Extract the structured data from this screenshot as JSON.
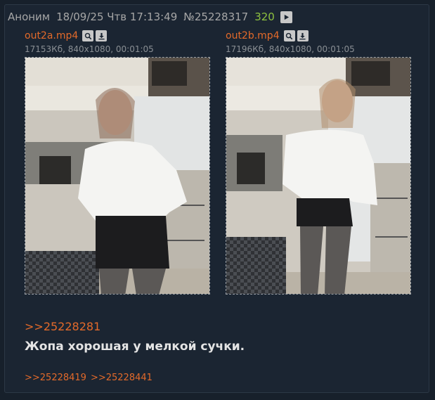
{
  "post": {
    "author": "Аноним",
    "date": "18/09/25 Чтв 17:13:49",
    "number": "№25228317",
    "replies_count": "320",
    "play_icon": "play-icon"
  },
  "files": [
    {
      "name": "out2a.mp4",
      "meta": "17153Кб, 840x1080, 00:01:05",
      "search_icon": "search-icon",
      "download_icon": "download-icon"
    },
    {
      "name": "out2b.mp4",
      "meta": "17196Кб, 840x1080, 00:01:05",
      "search_icon": "search-icon",
      "download_icon": "download-icon"
    }
  ],
  "reply_to": ">>25228281",
  "comment": "Жопа хорошая у мелкой сучки.",
  "backlinks": [
    ">>25228419",
    ">>25228441"
  ],
  "colors": {
    "background": "#17202b",
    "post_background": "#1b2532",
    "link": "#e36a2a",
    "replies_count": "#8ec23f",
    "header_text": "#a6a6a6",
    "comment_text": "#e4e4e4"
  }
}
